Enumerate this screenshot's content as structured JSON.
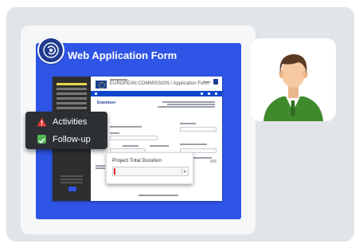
{
  "card": {
    "title": "Web Application Form"
  },
  "screen": {
    "header_text": "EUROPEAN COMMISSION / Application Form",
    "user_text": "Smith",
    "brand_text": "Erasmus+"
  },
  "popup": {
    "label": "Project Total Duration",
    "stepper": "▲"
  },
  "menu": {
    "items": [
      {
        "label": "Activities",
        "icon": "warning-icon",
        "color": "#e53935"
      },
      {
        "label": "Follow-up",
        "icon": "check-icon",
        "color": "#53b957"
      }
    ]
  },
  "colors": {
    "accent": "#2f55e6",
    "panel": "#e2e5e8",
    "menu_bg": "#2c2f33",
    "avatar_shirt": "#3f8a2c",
    "avatar_skin": "#f7c9a0",
    "avatar_hair": "#5a3a24"
  }
}
